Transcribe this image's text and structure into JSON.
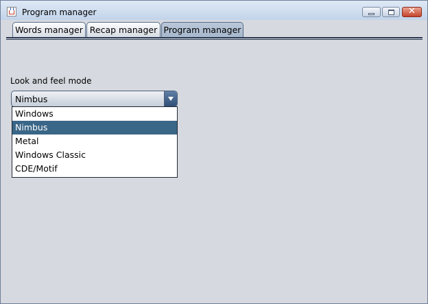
{
  "window": {
    "title": "Program manager"
  },
  "tabs": [
    {
      "label": "Words manager"
    },
    {
      "label": "Recap manager"
    },
    {
      "label": "Program manager"
    }
  ],
  "active_tab": 2,
  "look_and_feel": {
    "label": "Look and feel mode",
    "selected": "Nimbus",
    "options": [
      "Windows",
      "Nimbus",
      "Metal",
      "Windows Classic",
      "CDE/Motif"
    ]
  },
  "icons": {
    "app": "java-cup-icon",
    "minimize": "minimize-icon",
    "maximize": "maximize-icon",
    "close": "close-icon",
    "dropdown": "chevron-down-icon"
  },
  "colors": {
    "selection": "#3a6687",
    "background": "#d6d9df"
  }
}
